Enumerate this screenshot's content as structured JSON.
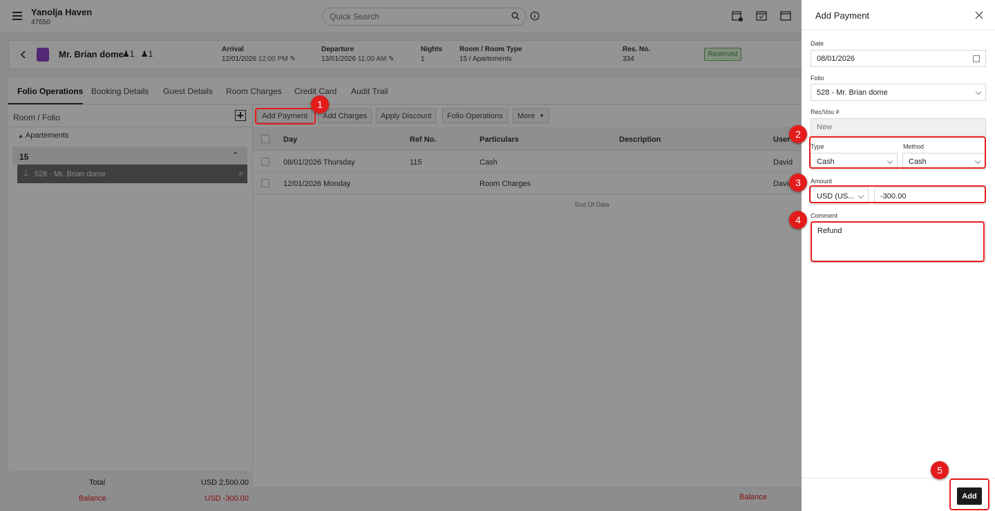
{
  "header": {
    "hotel_name": "Yanolja Haven",
    "hotel_id": "47650",
    "search_placeholder": "Quick Search"
  },
  "reservation": {
    "guest_name": "Mr. Brian dome",
    "adults": "1",
    "children": "1",
    "arrival_label": "Arrival",
    "arrival_date": "12/01/2026",
    "arrival_time": "12:00 PM",
    "departure_label": "Departure",
    "departure_date": "13/01/2026",
    "departure_time": "11:00 AM",
    "nights_label": "Nights",
    "nights": "1",
    "room_label": "Room / Room Type",
    "room": "15 / Apartements",
    "resno_label": "Res. No.",
    "resno": "334",
    "status": "Reserved"
  },
  "tabs": [
    "Folio Operations",
    "Booking Details",
    "Guest Details",
    "Room Charges",
    "Credit Card",
    "Audit Trail"
  ],
  "left_panel": {
    "title": "Room / Folio",
    "group": "Apartements",
    "room": "15",
    "folio": "528 - Mr. Brian dome",
    "total_label": "Total",
    "total_value": "USD 2,500.00",
    "balance_label": "Balance",
    "balance_value": "USD -300.00"
  },
  "toolbar": {
    "add_payment": "Add Payment",
    "add_charges": "Add Charges",
    "apply_discount": "Apply Discount",
    "folio_operations": "Folio Operations",
    "more": "More"
  },
  "grid": {
    "columns": [
      "Day",
      "Ref No.",
      "Particulars",
      "Description",
      "User"
    ],
    "rows": [
      {
        "day": "08/01/2026 Thursday",
        "ref": "115",
        "particulars": "Cash",
        "description": "",
        "user": "David"
      },
      {
        "day": "12/01/2026 Monday",
        "ref": "",
        "particulars": "Room Charges",
        "description": "",
        "user": "David"
      }
    ],
    "end_text": "End Of Data",
    "footer_balance": "Balance"
  },
  "drawer": {
    "title": "Add Payment",
    "date_label": "Date",
    "date_value": "08/01/2026",
    "folio_label": "Folio",
    "folio_value": "528 - Mr. Brian dome",
    "recvou_label": "Rec/Vou #",
    "recvou_placeholder": "New",
    "type_label": "Type",
    "type_value": "Cash",
    "method_label": "Method",
    "method_value": "Cash",
    "amount_label": "Amount",
    "currency_value": "USD (US...",
    "amount_value": "-300.00",
    "comment_label": "Comment",
    "comment_value": "Refund",
    "add_button": "Add"
  },
  "steps": [
    "1",
    "2",
    "3",
    "4",
    "5"
  ],
  "colors": {
    "highlight": "#e41b1b",
    "status_green": "#3f9b3f",
    "balance_red": "#e41b1b"
  }
}
